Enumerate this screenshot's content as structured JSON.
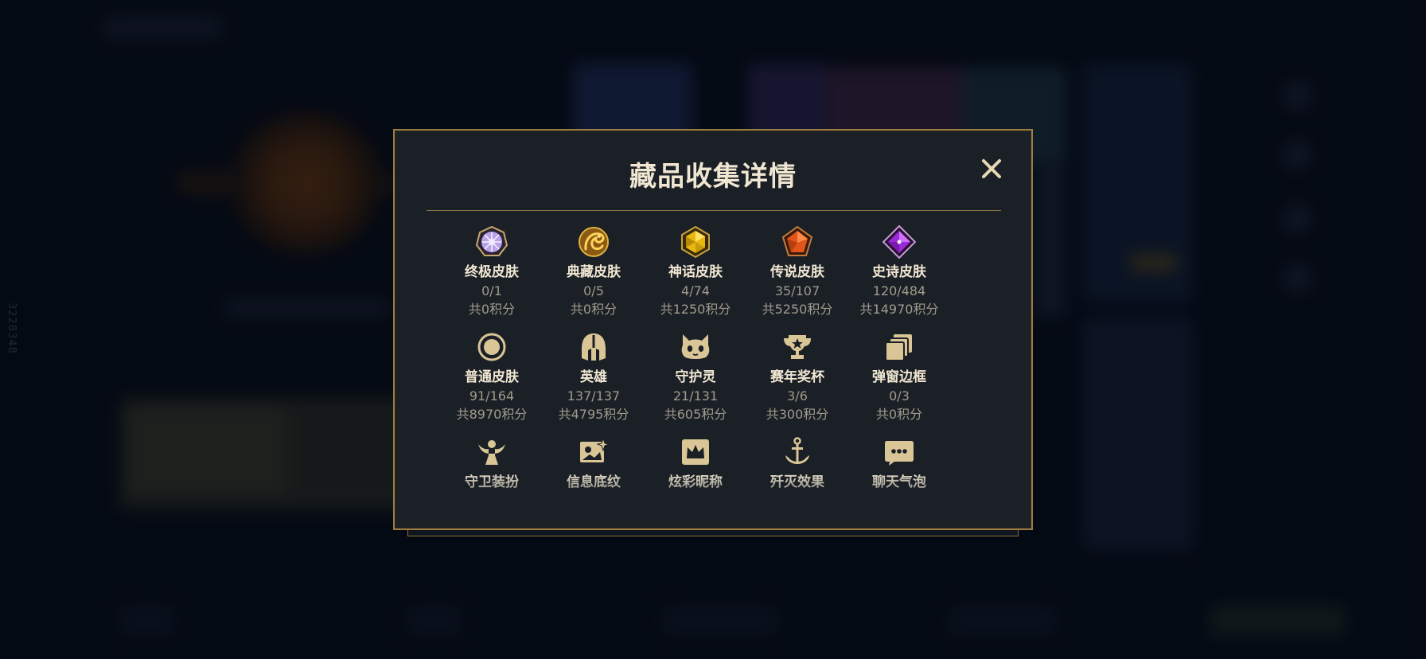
{
  "background": {
    "vertical_id": "3228348"
  },
  "modal": {
    "title": "藏品收集详情",
    "close_icon": "close-icon"
  },
  "items": [
    {
      "label": "终极皮肤",
      "count": "0/1",
      "points": "共0积分",
      "icon": "ultimate-skin-gem-icon"
    },
    {
      "label": "典藏皮肤",
      "count": "0/5",
      "points": "共0积分",
      "icon": "prestige-dragon-icon"
    },
    {
      "label": "神话皮肤",
      "count": "4/74",
      "points": "共1250积分",
      "icon": "mythic-gem-icon"
    },
    {
      "label": "传说皮肤",
      "count": "35/107",
      "points": "共5250积分",
      "icon": "legendary-gem-icon"
    },
    {
      "label": "史诗皮肤",
      "count": "120/484",
      "points": "共14970积分",
      "icon": "epic-gem-icon"
    },
    {
      "label": "普通皮肤",
      "count": "91/164",
      "points": "共8970积分",
      "icon": "circle-icon"
    },
    {
      "label": "英雄",
      "count": "137/137",
      "points": "共4795积分",
      "icon": "helmet-icon"
    },
    {
      "label": "守护灵",
      "count": "21/131",
      "points": "共605积分",
      "icon": "little-legend-icon"
    },
    {
      "label": "赛年奖杯",
      "count": "3/6",
      "points": "共300积分",
      "icon": "trophy-icon"
    },
    {
      "label": "弹窗边框",
      "count": "0/3",
      "points": "共0积分",
      "icon": "stacked-frames-icon"
    },
    {
      "label": "守卫装扮",
      "count": "",
      "points": "",
      "icon": "ward-icon"
    },
    {
      "label": "信息底纹",
      "count": "",
      "points": "",
      "icon": "banner-image-icon"
    },
    {
      "label": "炫彩昵称",
      "count": "",
      "points": "",
      "icon": "crown-badge-icon"
    },
    {
      "label": "歼灭效果",
      "count": "",
      "points": "",
      "icon": "anchor-icon"
    },
    {
      "label": "聊天气泡",
      "count": "",
      "points": "",
      "icon": "chat-bubble-icon"
    }
  ],
  "colors": {
    "gold_border": "#9c7d44",
    "title_text": "#f0e6d2",
    "sub_text": "#a09b8c",
    "icon_gold": "#d9c596"
  }
}
